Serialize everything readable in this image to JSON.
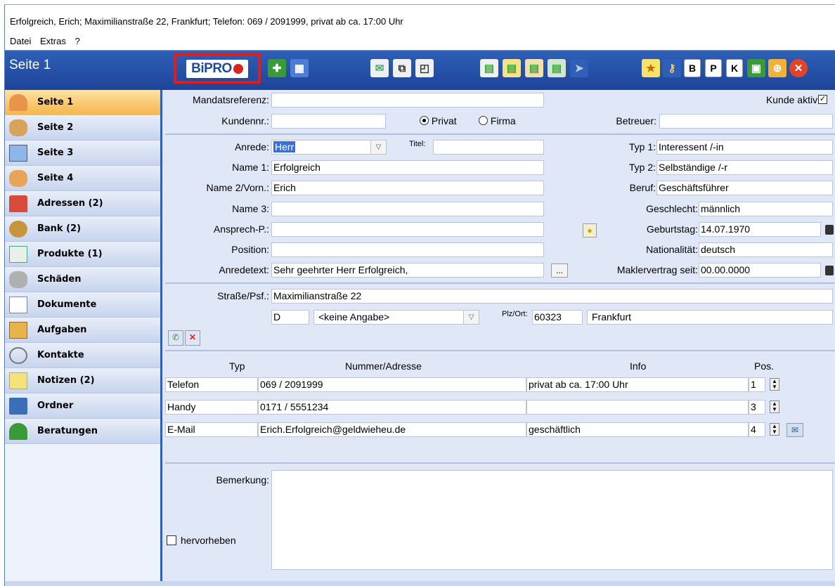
{
  "window": {
    "title": "Erfolgreich, Erich; Maximilianstraße 22, Frankfurt; Telefon: 069 / 2091999, privat ab ca. 17:00 Uhr"
  },
  "menu": {
    "datei": "Datei",
    "extras": "Extras",
    "help": "?"
  },
  "toolbar": {
    "page_title": "Seite 1",
    "bipro_label": "BiPRO",
    "btn_b": "B",
    "btn_p": "P",
    "btn_k": "K"
  },
  "sidebar": {
    "items": [
      {
        "label": "Seite 1",
        "icon": "person-icon"
      },
      {
        "label": "Seite 2",
        "icon": "people-icon"
      },
      {
        "label": "Seite 3",
        "icon": "id-card-icon"
      },
      {
        "label": "Seite 4",
        "icon": "person-edit-icon"
      },
      {
        "label": "Adressen (2)",
        "icon": "house-icon"
      },
      {
        "label": "Bank (2)",
        "icon": "money-bag-icon"
      },
      {
        "label": "Produkte (1)",
        "icon": "document-list-icon"
      },
      {
        "label": "Schäden",
        "icon": "wrench-icon"
      },
      {
        "label": "Dokumente",
        "icon": "document-icon"
      },
      {
        "label": "Aufgaben",
        "icon": "clipboard-check-icon"
      },
      {
        "label": "Kontakte",
        "icon": "paperclip-icon"
      },
      {
        "label": "Notizen (2)",
        "icon": "notes-icon"
      },
      {
        "label": "Ordner",
        "icon": "folder-icon"
      },
      {
        "label": "Beratungen",
        "icon": "palm-tree-icon"
      }
    ]
  },
  "form": {
    "mandat_label": "Mandatsreferenz:",
    "mandat_value": "",
    "kunde_aktiv_label": "Kunde aktiv:",
    "kunde_aktiv": true,
    "kundennr_label": "Kundennr.:",
    "kundennr_value": "",
    "privat_label": "Privat",
    "firma_label": "Firma",
    "type_selected": "Privat",
    "betreuer_label": "Betreuer:",
    "betreuer_value": "",
    "anrede_label": "Anrede:",
    "anrede_value": "Herr",
    "titel_label": "Titel:",
    "titel_value": "",
    "typ1_label": "Typ 1:",
    "typ1_value": "Interessent /-in",
    "name1_label": "Name 1:",
    "name1_value": "Erfolgreich",
    "typ2_label": "Typ 2:",
    "typ2_value": "Selbständige /-r",
    "name2_label": "Name 2/Vorn.:",
    "name2_value": "Erich",
    "beruf_label": "Beruf:",
    "beruf_value": "Geschäftsführer",
    "name3_label": "Name 3:",
    "name3_value": "",
    "geschlecht_label": "Geschlecht:",
    "geschlecht_value": "männlich",
    "ansprech_label": "Ansprech-P.:",
    "ansprech_value": "",
    "geburtstag_label": "Geburtstag:",
    "geburtstag_value": "14.07.1970",
    "position_label": "Position:",
    "position_value": "",
    "nationalitaet_label": "Nationalität:",
    "nationalitaet_value": "deutsch",
    "anredetext_label": "Anredetext:",
    "anredetext_value": "Sehr geehrter Herr Erfolgreich,",
    "ellipsis": "...",
    "maklervertrag_label": "Maklervertrag seit:",
    "maklervertrag_value": "00.00.0000",
    "strasse_label": "Straße/Psf.:",
    "strasse_value": "Maximilianstraße 22",
    "land_value": "D",
    "region_value": "<keine Angabe>",
    "plzort_label": "Plz/Ort:",
    "plz_value": "60323",
    "ort_value": "Frankfurt"
  },
  "contacts": {
    "headers": {
      "typ": "Typ",
      "nummer": "Nummer/Adresse",
      "info": "Info",
      "pos": "Pos."
    },
    "rows": [
      {
        "typ": "Telefon",
        "nummer": "069 / 2091999",
        "info": "privat ab ca. 17:00 Uhr",
        "pos": "1"
      },
      {
        "typ": "Handy",
        "nummer": "0171 / 5551234",
        "info": "",
        "pos": "3"
      },
      {
        "typ": "E-Mail",
        "nummer": "Erich.Erfolgreich@geldwieheu.de",
        "info": "geschäftlich",
        "pos": "4"
      }
    ]
  },
  "notes": {
    "bemerkung_label": "Bemerkung:",
    "bemerkung_value": "",
    "hervorheben_label": "hervorheben",
    "hervorheben": false
  },
  "colors": {
    "toolbar_blue": "#1d4499",
    "highlight_red": "#e21b1b",
    "active_orange": "#f5b54a"
  }
}
